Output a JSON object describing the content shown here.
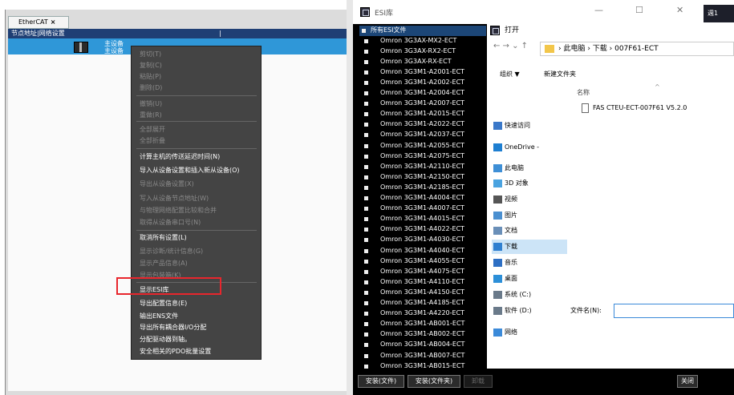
{
  "left_panel": {
    "tab_label": "EtherCAT",
    "tab_close": "×",
    "header_left": "节点地址|网络设置",
    "header_divider": "|",
    "node_label1": "主设备",
    "node_label2": "主设备",
    "context_menu": [
      {
        "label": "剪切(T)",
        "enabled": false
      },
      {
        "label": "复制(C)",
        "enabled": false
      },
      {
        "label": "粘贴(P)",
        "enabled": false
      },
      {
        "label": "删除(D)",
        "enabled": false
      },
      {
        "label": "撤销(U)",
        "enabled": false
      },
      {
        "label": "重做(R)",
        "enabled": false
      },
      {
        "label": "全部展开",
        "enabled": false
      },
      {
        "label": "全部折叠",
        "enabled": false
      },
      {
        "label": "计算主机的传送延迟时间(N)",
        "enabled": true
      },
      {
        "label": "导入从设备设置和插入新从设备(O)",
        "enabled": true
      },
      {
        "label": "导出从设备设置(X)",
        "enabled": false
      },
      {
        "label": "写入从设备节点地址(W)",
        "enabled": false
      },
      {
        "label": "与物理网络配置比较和合并",
        "enabled": false
      },
      {
        "label": "取得从设备串口号(N)",
        "enabled": false
      },
      {
        "label": "取消所有设置(L)",
        "enabled": true
      },
      {
        "label": "显示诊断/统计信息(G)",
        "enabled": false
      },
      {
        "label": "显示产品信息(A)",
        "enabled": false
      },
      {
        "label": "显示包装箱(K)",
        "enabled": false
      },
      {
        "label": "显示ESI库",
        "enabled": true
      },
      {
        "label": "导出配置信息(E)",
        "enabled": true
      },
      {
        "label": "输出ENS文件",
        "enabled": true
      },
      {
        "label": "导出所有耦合器I/O分配",
        "enabled": true
      },
      {
        "label": "分配驱动器到轴。",
        "enabled": true
      },
      {
        "label": "安全相关的PDO批量设置",
        "enabled": true
      }
    ]
  },
  "esi_window": {
    "title": "ESI库",
    "tree_root": "所有ESI文件",
    "files": [
      "Omron 3G3AX-MX2-ECT",
      "Omron 3G3AX-RX2-ECT",
      "Omron 3G3AX-RX-ECT",
      "Omron 3G3M1-A2001-ECT",
      "Omron 3G3M1-A2002-ECT",
      "Omron 3G3M1-A2004-ECT",
      "Omron 3G3M1-A2007-ECT",
      "Omron 3G3M1-A2015-ECT",
      "Omron 3G3M1-A2022-ECT",
      "Omron 3G3M1-A2037-ECT",
      "Omron 3G3M1-A2055-ECT",
      "Omron 3G3M1-A2075-ECT",
      "Omron 3G3M1-A2110-ECT",
      "Omron 3G3M1-A2150-ECT",
      "Omron 3G3M1-A2185-ECT",
      "Omron 3G3M1-A4004-ECT",
      "Omron 3G3M1-A4007-ECT",
      "Omron 3G3M1-A4015-ECT",
      "Omron 3G3M1-A4022-ECT",
      "Omron 3G3M1-A4030-ECT",
      "Omron 3G3M1-A4040-ECT",
      "Omron 3G3M1-A4055-ECT",
      "Omron 3G3M1-A4075-ECT",
      "Omron 3G3M1-A4110-ECT",
      "Omron 3G3M1-A4150-ECT",
      "Omron 3G3M1-A4185-ECT",
      "Omron 3G3M1-A4220-ECT",
      "Omron 3G3M1-AB001-ECT",
      "Omron 3G3M1-AB002-ECT",
      "Omron 3G3M1-AB004-ECT",
      "Omron 3G3M1-AB007-ECT",
      "Omron 3G3M1-AB015-ECT"
    ],
    "btn_install_file": "安装(文件)",
    "btn_install_folder": "安装(文件夹)",
    "btn_uninstall": "卸载",
    "btn_close": "关闭",
    "minimize": "—",
    "maximize": "☐",
    "close": "✕",
    "corner_text": "週1"
  },
  "open_dialog": {
    "title": "打开",
    "nav_buttons": "←  →  ⌄  ↑",
    "breadcrumb": "›  此电脑  ›  下载  ›  007F61-ECT",
    "organize": "组织 ▼",
    "new_folder": "新建文件夹",
    "sort_caret": "^",
    "col_name": "名称",
    "file_name": "FAS CTEU-ECT-007F61 V5.2.0",
    "sidebar": [
      "快速访问",
      "OneDrive -",
      "此电脑",
      "3D 对象",
      "视频",
      "图片",
      "文档",
      "下载",
      "音乐",
      "桌面",
      "系统 (C:)",
      "软件 (D:)",
      "网络"
    ],
    "filename_label": "文件名(N):"
  },
  "colors": {
    "menu_bg": "#444444",
    "highlight": "#e8262d",
    "node": "#2f97d8",
    "header": "#1f3f74"
  }
}
